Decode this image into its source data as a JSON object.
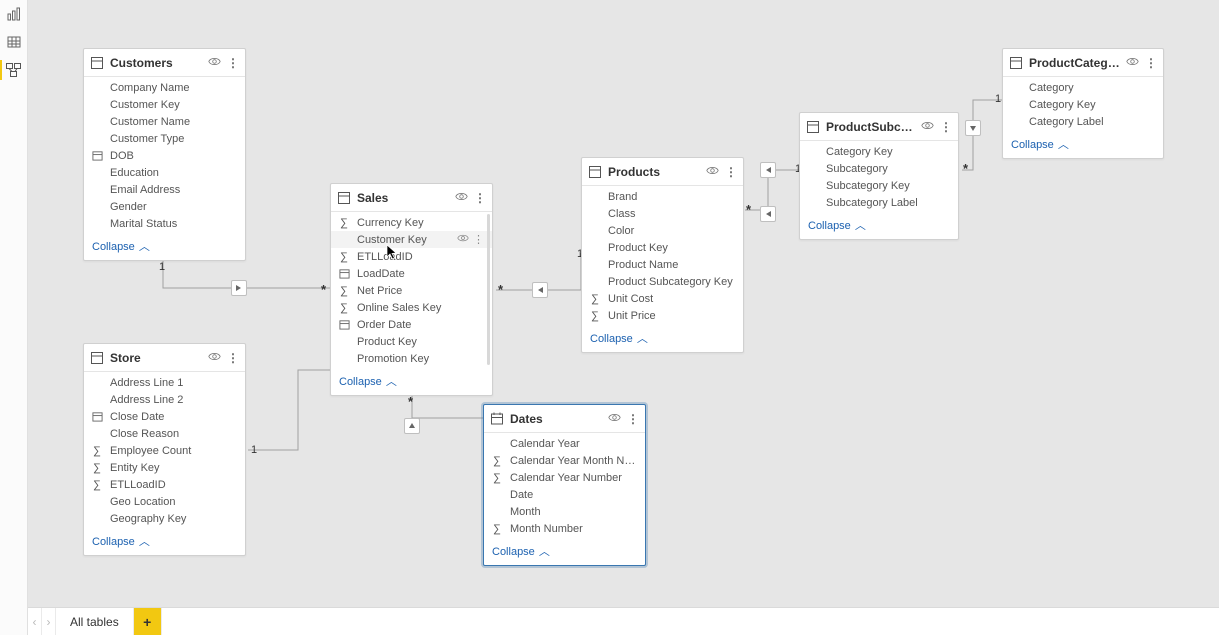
{
  "leftRail": {
    "report": "Report view",
    "data": "Data view",
    "model": "Model view"
  },
  "bottom": {
    "prev": "‹",
    "next": "›",
    "allTables": "All tables",
    "add": "+"
  },
  "common": {
    "collapse": "Collapse"
  },
  "tables": {
    "customers": {
      "title": "Customers",
      "fields": {
        "f0": "Company Name",
        "f1": "Customer Key",
        "f2": "Customer Name",
        "f3": "Customer Type",
        "f4": "DOB",
        "f5": "Education",
        "f6": "Email Address",
        "f7": "Gender",
        "f8": "Marital Status"
      }
    },
    "sales": {
      "title": "Sales",
      "fields": {
        "f0": "Currency Key",
        "f1": "Customer Key",
        "f2": "ETLLoadID",
        "f3": "LoadDate",
        "f4": "Net Price",
        "f5": "Online Sales Key",
        "f6": "Order Date",
        "f7": "Product Key",
        "f8": "Promotion Key"
      }
    },
    "store": {
      "title": "Store",
      "fields": {
        "f0": "Address Line 1",
        "f1": "Address Line 2",
        "f2": "Close Date",
        "f3": "Close Reason",
        "f4": "Employee Count",
        "f5": "Entity Key",
        "f6": "ETLLoadID",
        "f7": "Geo Location",
        "f8": "Geography Key"
      }
    },
    "products": {
      "title": "Products",
      "fields": {
        "f0": "Brand",
        "f1": "Class",
        "f2": "Color",
        "f3": "Product Key",
        "f4": "Product Name",
        "f5": "Product Subcategory Key",
        "f6": "Unit Cost",
        "f7": "Unit Price"
      }
    },
    "dates": {
      "title": "Dates",
      "fields": {
        "f0": "Calendar Year",
        "f1": "Calendar Year Month Number",
        "f2": "Calendar Year Number",
        "f3": "Date",
        "f4": "Month",
        "f5": "Month Number"
      }
    },
    "subcategory": {
      "title": "ProductSubcategory",
      "fields": {
        "f0": "Category Key",
        "f1": "Subcategory",
        "f2": "Subcategory Key",
        "f3": "Subcategory Label"
      }
    },
    "category": {
      "title": "ProductCategory",
      "fields": {
        "f0": "Category",
        "f1": "Category Key",
        "f2": "Category Label"
      }
    }
  }
}
